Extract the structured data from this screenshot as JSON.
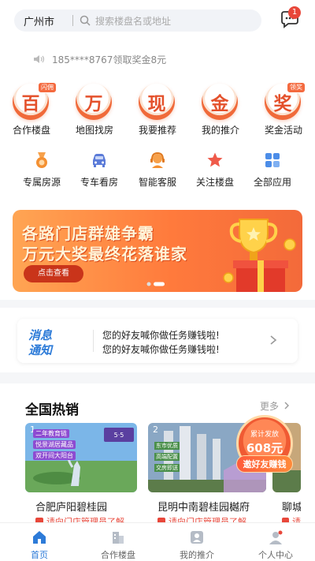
{
  "header": {
    "city": "广州市",
    "search_placeholder": "搜索楼盘名或地址",
    "message_badge": "1"
  },
  "notice": {
    "text": "185****8767领取奖金8元"
  },
  "main_grid": [
    {
      "char": "百",
      "label": "合作楼盘",
      "tag": "闪佣"
    },
    {
      "char": "万",
      "label": "地图找房",
      "tag": ""
    },
    {
      "char": "现",
      "label": "我要推荐",
      "tag": ""
    },
    {
      "char": "金",
      "label": "我的推介",
      "tag": ""
    },
    {
      "char": "奖",
      "label": "奖金活动",
      "tag": "领奖"
    }
  ],
  "sub_grid": [
    {
      "label": "专属房源",
      "icon": "medal-icon"
    },
    {
      "label": "专车看房",
      "icon": "car-icon"
    },
    {
      "label": "智能客服",
      "icon": "service-icon"
    },
    {
      "label": "关注楼盘",
      "icon": "star-icon"
    },
    {
      "label": "全部应用",
      "icon": "apps-icon"
    }
  ],
  "banner": {
    "line1": "各路门店群雄争霸",
    "line2": "万元大奖最终花落谁家",
    "button": "点击查看"
  },
  "message_card": {
    "logo_line1": "消息",
    "logo_line2": "通知",
    "line1": "您的好友喊你做任务赚钱啦!",
    "line2": "您的好友喊你做任务赚钱啦!"
  },
  "hot": {
    "title": "全国热销",
    "more": "更多",
    "promo_line1": "累计发放",
    "promo_amount": "608元",
    "promo_button": "邀好友赚钱",
    "cards": [
      {
        "num": "1",
        "name": "合肥庐阳碧桂园",
        "tip": "请向门店管理员了解",
        "tags": [
          "二年教育链",
          "悦景湖居藏品",
          "双开间大阳台"
        ]
      },
      {
        "num": "2",
        "name": "昆明中南碧桂园樾府",
        "tip": "请向门店管理员了解",
        "tags": [
          "东市优质",
          "高端配置",
          "交房即送"
        ]
      },
      {
        "num": "",
        "name": "聊城",
        "tip": "请",
        "tags": []
      }
    ]
  },
  "tabbar": [
    {
      "label": "首页",
      "active": true
    },
    {
      "label": "合作楼盘",
      "active": false
    },
    {
      "label": "我的推介",
      "active": false
    },
    {
      "label": "个人中心",
      "active": false
    }
  ],
  "colors": {
    "accent_orange": "#f06a3a",
    "brand_blue": "#2d7bd8",
    "alert_red": "#e8473a"
  }
}
